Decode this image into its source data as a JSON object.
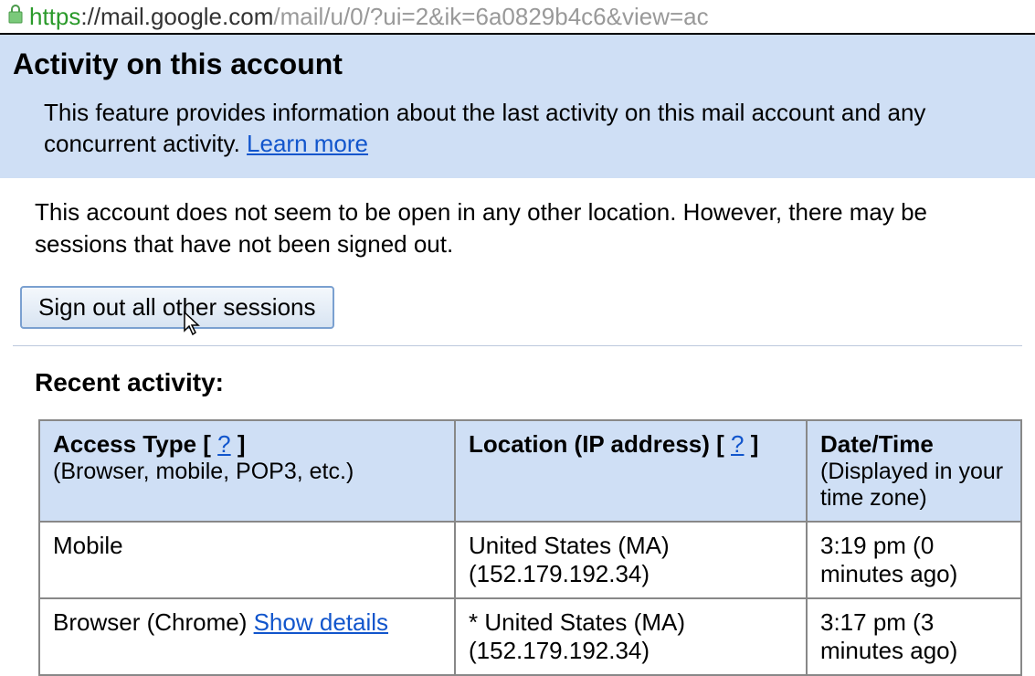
{
  "url": {
    "protocol": "https",
    "domain": "://mail.google.com",
    "path": "/mail/u/0/?ui=2&ik=6a0829b4c6&view=ac"
  },
  "header": {
    "title": "Activity on this account",
    "description_part1": "This feature provides information about the last activity on this mail account and any concurrent activity. ",
    "learn_more": "Learn more"
  },
  "status": {
    "text": "This account does not seem to be open in any other location. However, there may be sessions that have not been signed out."
  },
  "button": {
    "signout_label": "Sign out all other sessions"
  },
  "recent": {
    "heading": "Recent activity:"
  },
  "table": {
    "headers": {
      "access_type": "Access Type ",
      "access_type_sub": "(Browser, mobile, POP3, etc.)",
      "location": "Location (IP address) ",
      "datetime": "Date/Time",
      "datetime_sub": "(Displayed in your time zone)",
      "help": "?"
    },
    "rows": [
      {
        "access_type": "Mobile",
        "show_details": "",
        "location_line1": "United States (MA)",
        "location_line2": "(152.179.192.34)",
        "datetime": "3:19 pm (0 minutes ago)"
      },
      {
        "access_type": "Browser (Chrome) ",
        "show_details": "Show details",
        "location_line1": "* United States (MA)",
        "location_line2": "(152.179.192.34)",
        "datetime": "3:17 pm (3 minutes ago)"
      }
    ]
  }
}
